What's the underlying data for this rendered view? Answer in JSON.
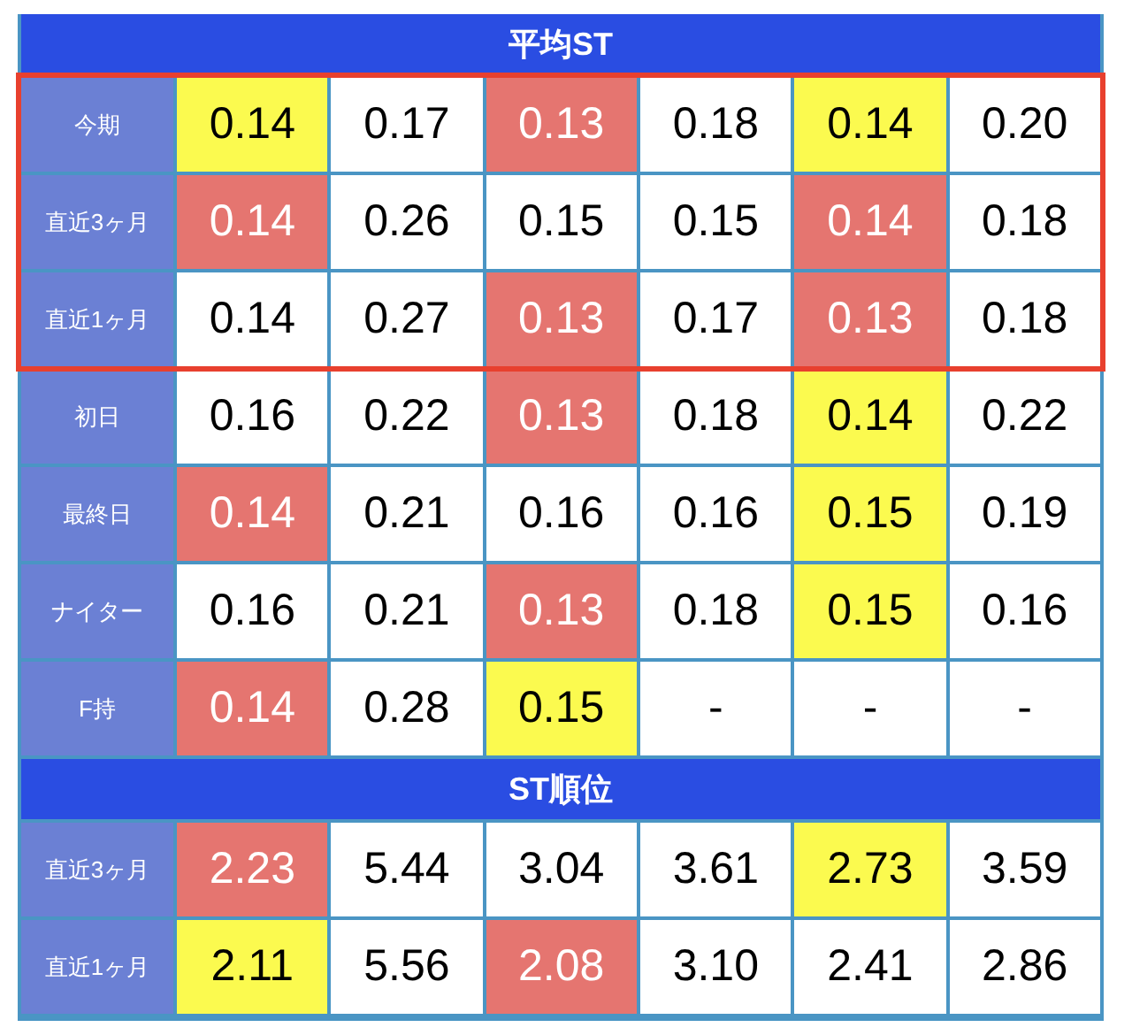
{
  "sections": [
    {
      "title": "平均ST",
      "groups": [
        {
          "outlined": true,
          "rows": [
            {
              "label": "今期",
              "cells": [
                {
                  "value": "0.14",
                  "color": "#fbfa4f"
                },
                {
                  "value": "0.17"
                },
                {
                  "value": "0.13",
                  "color": "#e57570"
                },
                {
                  "value": "0.18"
                },
                {
                  "value": "0.14",
                  "color": "#fbfa4f"
                },
                {
                  "value": "0.20"
                }
              ]
            },
            {
              "label": "直近3ヶ月",
              "cells": [
                {
                  "value": "0.14",
                  "color": "#e57570"
                },
                {
                  "value": "0.26"
                },
                {
                  "value": "0.15"
                },
                {
                  "value": "0.15"
                },
                {
                  "value": "0.14",
                  "color": "#e57570"
                },
                {
                  "value": "0.18"
                }
              ]
            },
            {
              "label": "直近1ヶ月",
              "cells": [
                {
                  "value": "0.14"
                },
                {
                  "value": "0.27"
                },
                {
                  "value": "0.13",
                  "color": "#e57570"
                },
                {
                  "value": "0.17"
                },
                {
                  "value": "0.13",
                  "color": "#e57570"
                },
                {
                  "value": "0.18"
                }
              ]
            }
          ]
        },
        {
          "outlined": false,
          "rows": [
            {
              "label": "初日",
              "cells": [
                {
                  "value": "0.16"
                },
                {
                  "value": "0.22"
                },
                {
                  "value": "0.13",
                  "color": "#e57570"
                },
                {
                  "value": "0.18"
                },
                {
                  "value": "0.14",
                  "color": "#fbfa4f"
                },
                {
                  "value": "0.22"
                }
              ]
            },
            {
              "label": "最終日",
              "cells": [
                {
                  "value": "0.14",
                  "color": "#e57570"
                },
                {
                  "value": "0.21"
                },
                {
                  "value": "0.16"
                },
                {
                  "value": "0.16"
                },
                {
                  "value": "0.15",
                  "color": "#fbfa4f"
                },
                {
                  "value": "0.19"
                }
              ]
            },
            {
              "label": "ナイター",
              "cells": [
                {
                  "value": "0.16"
                },
                {
                  "value": "0.21"
                },
                {
                  "value": "0.13",
                  "color": "#e57570"
                },
                {
                  "value": "0.18"
                },
                {
                  "value": "0.15",
                  "color": "#fbfa4f"
                },
                {
                  "value": "0.16"
                }
              ]
            },
            {
              "label": "F持",
              "cells": [
                {
                  "value": "0.14",
                  "color": "#e57570"
                },
                {
                  "value": "0.28"
                },
                {
                  "value": "0.15",
                  "color": "#fbfa4f"
                },
                {
                  "value": "-"
                },
                {
                  "value": "-"
                },
                {
                  "value": "-"
                }
              ]
            }
          ]
        }
      ]
    },
    {
      "title": "ST順位",
      "groups": [
        {
          "outlined": false,
          "rows": [
            {
              "label": "直近3ヶ月",
              "cells": [
                {
                  "value": "2.23",
                  "color": "#e57570"
                },
                {
                  "value": "5.44"
                },
                {
                  "value": "3.04"
                },
                {
                  "value": "3.61"
                },
                {
                  "value": "2.73",
                  "color": "#fbfa4f"
                },
                {
                  "value": "3.59"
                }
              ]
            },
            {
              "label": "直近1ヶ月",
              "cells": [
                {
                  "value": "2.11",
                  "color": "#fbfa4f"
                },
                {
                  "value": "5.56"
                },
                {
                  "value": "2.08",
                  "color": "#e57570"
                },
                {
                  "value": "3.10"
                },
                {
                  "value": "2.41"
                },
                {
                  "value": "2.86"
                }
              ]
            }
          ]
        }
      ]
    }
  ]
}
